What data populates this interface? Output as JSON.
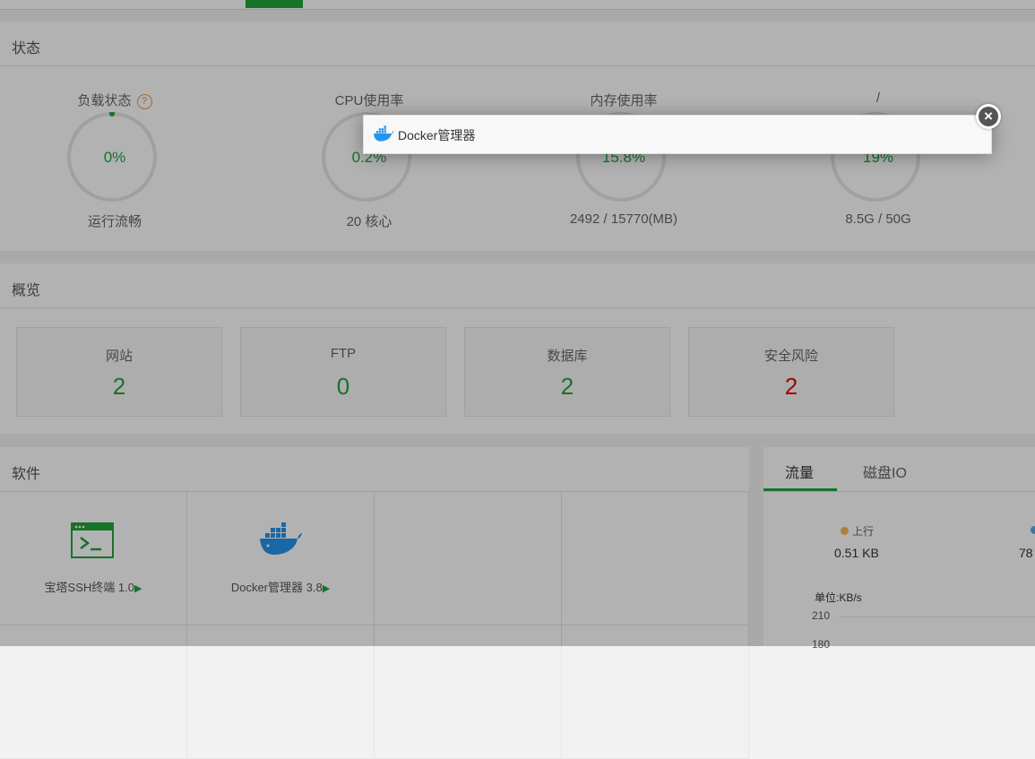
{
  "status": {
    "title": "状态",
    "gauges": [
      {
        "title": "负载状态",
        "value": "0%",
        "foot": "运行流畅",
        "percent": 0
      },
      {
        "title": "CPU使用率",
        "value": "0.2%",
        "foot": "20 核心",
        "percent": 0.2
      },
      {
        "title": "内存使用率",
        "value": "15.8%",
        "foot": "2492 / 15770(MB)",
        "percent": 15.8
      },
      {
        "title": "/",
        "value": "19%",
        "foot": "8.5G / 50G",
        "percent": 19
      }
    ],
    "help_icon": "?"
  },
  "overview": {
    "title": "概览",
    "cards": [
      {
        "label": "网站",
        "value": "2"
      },
      {
        "label": "FTP",
        "value": "0"
      },
      {
        "label": "数据库",
        "value": "2"
      },
      {
        "label": "安全风险",
        "value": "2"
      }
    ]
  },
  "software": {
    "title": "软件",
    "items": [
      {
        "name": "宝塔SSH终端 1.0",
        "icon": "terminal-icon"
      },
      {
        "name": "Docker管理器 3.8",
        "icon": "docker-icon"
      }
    ],
    "play_glyph": "▶"
  },
  "traffic": {
    "tabs": [
      "流量",
      "磁盘IO"
    ],
    "upload_label": "上行",
    "upload_value": "0.51 KB",
    "download_value": "78",
    "unit_label": "单位:KB/s",
    "y_ticks": [
      "210",
      "180"
    ],
    "colors": {
      "upload": "#f7b851",
      "download": "#52a9ff"
    }
  },
  "modal": {
    "title": "Docker管理器",
    "close_glyph": "×"
  },
  "colors": {
    "accent": "#20a53a",
    "danger": "#ee0000"
  }
}
